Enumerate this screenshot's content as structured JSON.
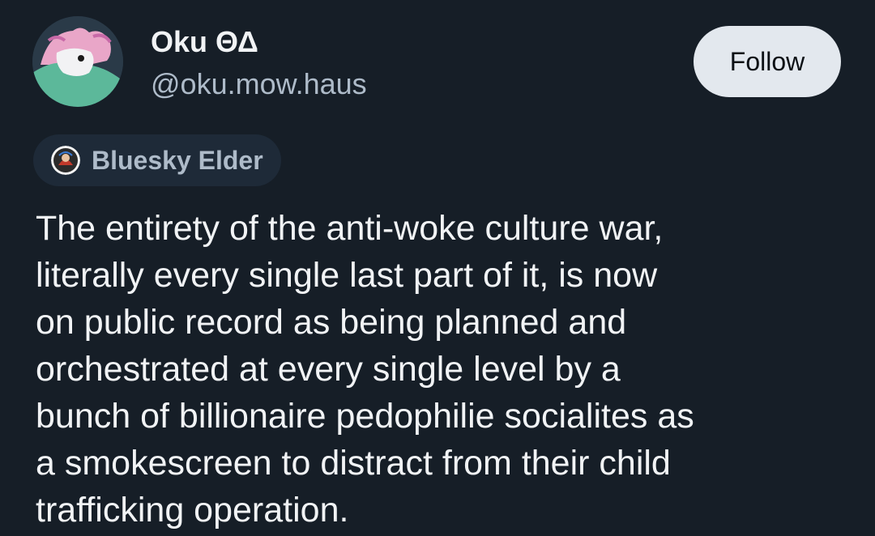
{
  "author": {
    "display_name": "Oku ΘΔ",
    "handle": "@oku.mow.haus"
  },
  "follow_label": "Follow",
  "badge": {
    "label": "Bluesky Elder"
  },
  "post": {
    "lines": [
      "The entirety of the anti-woke culture war,",
      "literally every single last part of it, is now",
      "on public record as being planned and",
      "orchestrated at every single level by a",
      "bunch of billionaire pedophilie socialites as",
      "a smokescreen to distract from their child",
      "trafficking operation."
    ]
  },
  "colors": {
    "background": "#161e27",
    "text": "#f1f3f5",
    "muted": "#aebbc9",
    "button_bg": "#e3e8ee",
    "badge_bg": "#1e2a38"
  },
  "icons": {
    "avatar": "avatar-image",
    "badge": "badge-avatar-icon"
  }
}
